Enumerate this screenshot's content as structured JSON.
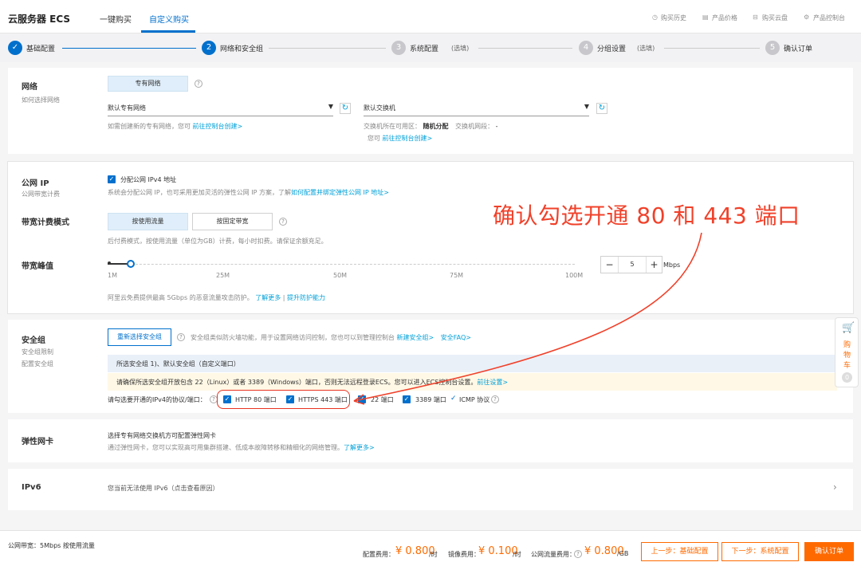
{
  "header": {
    "title": "云服务器 ECS",
    "tabs": [
      "一键购买",
      "自定义购买"
    ],
    "links": [
      "购买历史",
      "产品价格",
      "购买云盘",
      "产品控制台"
    ]
  },
  "steps": [
    {
      "label": "基础配置",
      "num": "✓",
      "note": ""
    },
    {
      "label": "网络和安全组",
      "num": "2",
      "note": ""
    },
    {
      "label": "系统配置",
      "num": "3",
      "note": "(选填)"
    },
    {
      "label": "分组设置",
      "num": "4",
      "note": "(选填)"
    },
    {
      "label": "确认订单",
      "num": "5",
      "note": ""
    }
  ],
  "network": {
    "label": "网络",
    "sublabel": "如何选择网络",
    "vpc_button": "专有网络",
    "vpc_select": "默认专有网络",
    "vswitch_select": "默认交换机",
    "vpc_hint": "如需创建新的专有网络，您可",
    "vpc_hint_link": "前往控制台创建>",
    "zone_label": "交换机所在可用区：",
    "zone_value": "随机分配",
    "segment_label": "交换机网段：",
    "segment_value": "-",
    "vswitch_hint": "您可",
    "vswitch_hint_link": "前往控制台创建>"
  },
  "public_ip": {
    "label": "公网 IP",
    "sublabel": "公网带宽计费",
    "checkbox_label": "分配公网 IPv4 地址",
    "desc": "系统会分配公网 IP，也可采用更加灵活的弹性公网 IP 方案，了解",
    "desc_link": "如何配置并绑定弹性公网 IP 地址>"
  },
  "billing": {
    "label": "带宽计费模式",
    "opt1": "按使用流量",
    "opt2": "按固定带宽",
    "desc": "后付费模式，按使用流量（单位为GB）计费，每小时扣费。请保证余额充足。"
  },
  "bandwidth": {
    "label": "带宽峰值",
    "ticks": [
      "1M",
      "25M",
      "50M",
      "75M",
      "100M"
    ],
    "value": "5",
    "minus": "−",
    "plus": "+",
    "unit": "Mbps",
    "level": 0.05,
    "desc": "阿里云免费提供最高 5Gbps 的恶意流量攻击防护。",
    "desc_link1": "了解更多",
    "desc_sep": "|",
    "desc_link2": "提升防护能力"
  },
  "annotation": {
    "text": "确认勾选开通 80 和 443 端口",
    "color": "#f0412a"
  },
  "security": {
    "label": "安全组",
    "sublabel1": "安全组限制",
    "sublabel2": "配置安全组",
    "button": "重新选择安全组",
    "desc": "安全组类似防火墙功能，用于设置网络访问控制，您也可以到管理控制台",
    "link1": "新建安全组>",
    "link2": "安全FAQ>",
    "selected": "所选安全组 1)、默认安全组（自定义端口）",
    "warning": "请确保所选安全组开放包含 22（Linux）或者 3389（Windows）端口，否则无法远程登录ECS。您可以进入ECS控制台设置。",
    "warning_link": "前往设置>",
    "ports_label": "请勾选要开通的IPv4的协议/端口：",
    "ports": [
      "HTTP 80 端口",
      "HTTPS 443 端口",
      "22 端口",
      "3389 端口"
    ],
    "icmp": "ICMP 协议"
  },
  "eni": {
    "label": "弹性网卡",
    "line1": "选择专有网络交换机方可配置弹性网卡",
    "line2": "通过弹性网卡，您可以实现高可用集群搭建、低成本故障转移和精细化的网络管理。",
    "link": "了解更多>"
  },
  "ipv6": {
    "label": "IPv6",
    "text": "您当前无法使用 IPv6（点击查看原因）",
    "arrow": "›"
  },
  "cart": {
    "chars": [
      "购",
      "物",
      "车"
    ],
    "count": "0"
  },
  "footer": {
    "summary": "公网带宽：5Mbps 按使用流量",
    "config_label": "配置费用：",
    "config_price": "¥ 0.800",
    "config_unit": "/时",
    "image_label": "镜像费用：",
    "image_price": "¥ 0.100",
    "image_unit": "/时",
    "traffic_label": "公网流量费用：",
    "traffic_price": "¥ 0.800",
    "traffic_unit": "/GB",
    "prev_button": "上一步：基础配置",
    "next_button": "下一步：系统配置",
    "confirm_button": "确认订单"
  },
  "colors": {
    "accent": "#0070cc",
    "link": "#00a0d8",
    "orange": "#ff6a00",
    "annotation": "#f0412a"
  }
}
